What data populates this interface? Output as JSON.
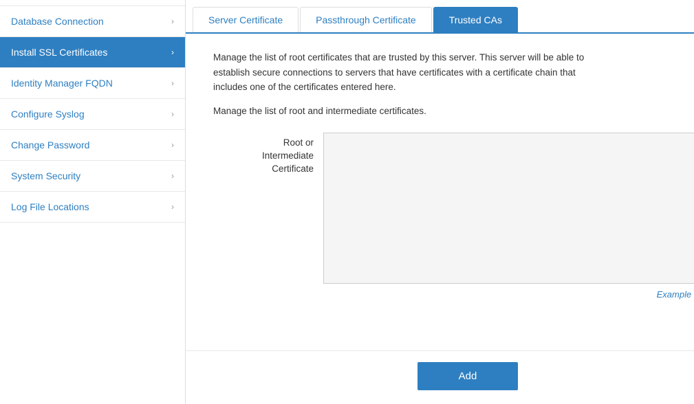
{
  "sidebar": {
    "items": [
      {
        "label": "Database Connection",
        "active": false
      },
      {
        "label": "Install SSL Certificates",
        "active": true
      },
      {
        "label": "Identity Manager FQDN",
        "active": false
      },
      {
        "label": "Configure Syslog",
        "active": false
      },
      {
        "label": "Change Password",
        "active": false
      },
      {
        "label": "System Security",
        "active": false
      },
      {
        "label": "Log File Locations",
        "active": false
      }
    ]
  },
  "tabs": [
    {
      "label": "Server Certificate",
      "active": false
    },
    {
      "label": "Passthrough Certificate",
      "active": false
    },
    {
      "label": "Trusted CAs",
      "active": true
    }
  ],
  "content": {
    "description": "Manage the list of root certificates that are trusted by this server. This server will be able to establish secure connections to servers that have certificates with a certificate chain that includes one of the certificates entered here.",
    "manage_text": "Manage the list of root and intermediate certificates.",
    "form_label_line1": "Root or",
    "form_label_line2": "Intermediate",
    "form_label_line3": "Certificate",
    "textarea_placeholder": "",
    "example_link": "Example Format",
    "add_button": "Add"
  }
}
